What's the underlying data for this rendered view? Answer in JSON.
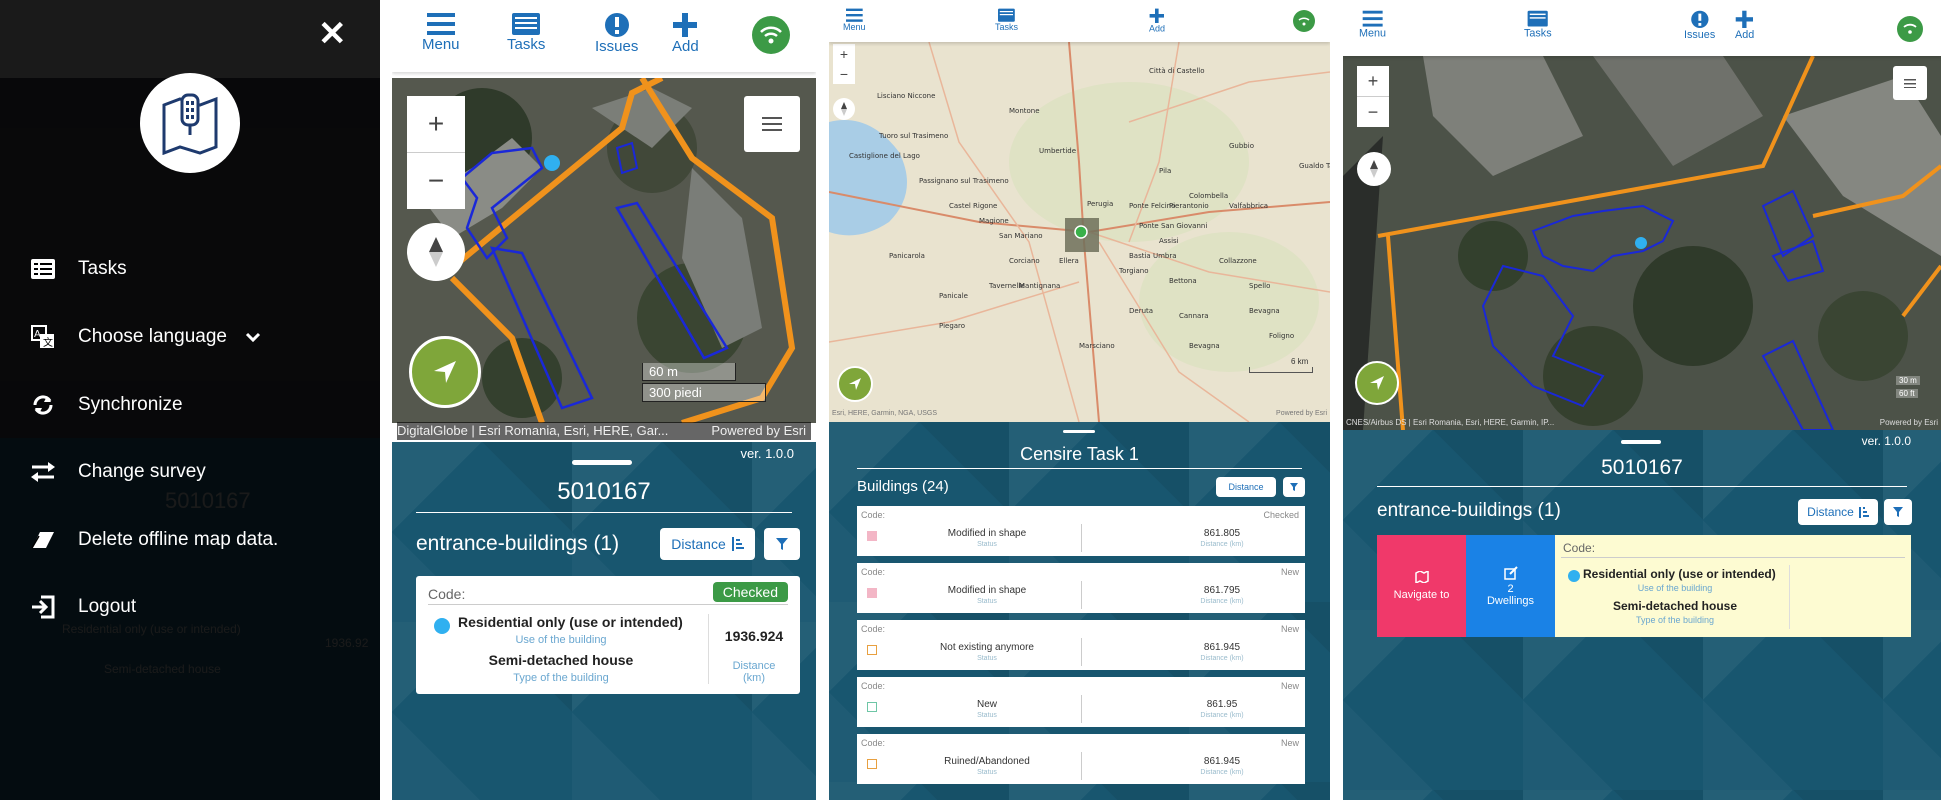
{
  "menu": {
    "items": [
      {
        "label": "Tasks",
        "icon": "list-icon"
      },
      {
        "label": "Choose language",
        "icon": "translate-icon"
      },
      {
        "label": "Synchronize",
        "icon": "sync-icon"
      },
      {
        "label": "Change survey",
        "icon": "swap-icon"
      },
      {
        "label": "Delete offline map data.",
        "icon": "eraser-icon"
      },
      {
        "label": "Logout",
        "icon": "logout-icon"
      }
    ],
    "background_ghost": {
      "code": "5010167",
      "row": "Residential only (use or intended)",
      "type": "Semi-detached house",
      "distance": "1936.92"
    }
  },
  "toolbar": {
    "menu": "Menu",
    "tasks": "Tasks",
    "issues": "Issues",
    "add": "Add"
  },
  "panel2": {
    "scale_m": "60 m",
    "scale_ft": "300 piedi",
    "attribution": "DigitalGlobe | Esri Romania, Esri, HERE, Gar...",
    "powered": "Powered by Esri",
    "version": "ver. 1.0.0",
    "code": "5010167",
    "section_title": "entrance-buildings (1)",
    "distance_btn": "Distance",
    "card": {
      "code_label": "Code:",
      "status": "Checked",
      "use": "Residential only (use or intended)",
      "use_label": "Use of the building",
      "type": "Semi-detached house",
      "type_label": "Type of the building",
      "distance": "1936.924",
      "distance_label": "Distance (km)"
    }
  },
  "panel3": {
    "places": [
      "Castiglione del Lago",
      "Lisciano Niccone",
      "Umbertide",
      "Montone",
      "Città di Castello",
      "Gubbio",
      "Perugia",
      "Corciano",
      "Magione",
      "Passignano sul Trasimeno",
      "Tuoro sul Trasimeno",
      "Assisi",
      "Bastia Umbra",
      "Torgiano",
      "Deruta",
      "Marsciano",
      "Panicale",
      "Piegaro",
      "Collazzone",
      "Bettona",
      "Valfabbrica",
      "Gualdo Tadino",
      "Spello",
      "Foligno",
      "Bevagna",
      "Cannara",
      "San Mariano",
      "Ponte San Giovanni",
      "Ponte Felcino",
      "Pierantonio",
      "Castel Rigone",
      "Panicarola",
      "Tavernelle",
      "Ellera",
      "Mantignana",
      "Colombella",
      "Pila",
      "Bevagna"
    ],
    "attribution": "Esri, HERE, Garmin, NGA, USGS",
    "powered": "Powered by Esri",
    "scale": "6 km",
    "task_title": "Censire Task 1",
    "buildings": "Buildings (24)",
    "distance_btn": "Distance",
    "rows": [
      {
        "code": "Code:",
        "state": "Checked",
        "status": "Modified in shape",
        "status_label": "Status",
        "distance": "861.805",
        "distance_label": "Distance (km)",
        "color": "#f3b6c6"
      },
      {
        "code": "Code:",
        "state": "New",
        "status": "Modified in shape",
        "status_label": "Status",
        "distance": "861.795",
        "distance_label": "Distance (km)",
        "color": "#f3b6c6"
      },
      {
        "code": "Code:",
        "state": "New",
        "status": "Not existing anymore",
        "status_label": "Status",
        "distance": "861.945",
        "distance_label": "Distance (km)",
        "color": "#e8a040"
      },
      {
        "code": "Code:",
        "state": "New",
        "status": "New",
        "status_label": "Status",
        "distance": "861.95",
        "distance_label": "Distance (km)",
        "color": "#6ec6a6"
      },
      {
        "code": "Code:",
        "state": "New",
        "status": "Ruined/Abandoned",
        "status_label": "Status",
        "distance": "861.945",
        "distance_label": "Distance (km)",
        "color": "#e8a040"
      }
    ]
  },
  "panel4": {
    "scale_m": "30 m",
    "scale_ft": "60 ft",
    "attribution": "CNES/Airbus DS | Esri Romania, Esri, HERE, Garmin, IP...",
    "powered": "Powered by Esri",
    "version": "ver. 1.0.0",
    "code": "5010167",
    "section_title": "entrance-buildings (1)",
    "distance_btn": "Distance",
    "navigate": "Navigate to",
    "dwellings_count": "2",
    "dwellings": "Dwellings",
    "card": {
      "code_label": "Code:",
      "use": "Residential only (use or intended)",
      "use_label": "Use of the building",
      "type": "Semi-detached house",
      "type_label": "Type of the building"
    }
  },
  "colors": {
    "accent": "#1e6fb8",
    "panel_bg": "#18566f",
    "boundary": "#f0921c",
    "building": "#1a28d8",
    "nav": "#f0396a",
    "dwellings": "#1a82e6",
    "card_highlight": "#fdfbd2",
    "locate": "#7fa63a",
    "status_green": "#3c9a46"
  }
}
